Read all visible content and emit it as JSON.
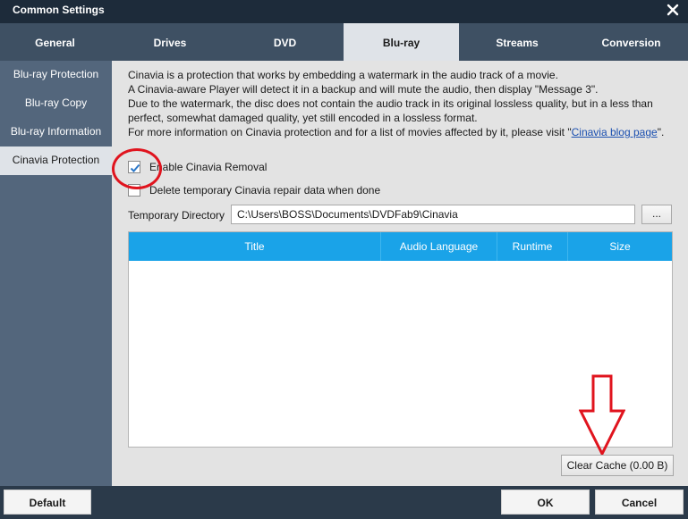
{
  "window": {
    "title": "Common Settings",
    "close_icon": "close-icon"
  },
  "tabs": [
    {
      "label": "General"
    },
    {
      "label": "Drives"
    },
    {
      "label": "DVD"
    },
    {
      "label": "Blu-ray",
      "active": true
    },
    {
      "label": "Streams"
    },
    {
      "label": "Conversion"
    }
  ],
  "sidebar": {
    "items": [
      {
        "label": "Blu-ray Protection"
      },
      {
        "label": "Blu-ray Copy"
      },
      {
        "label": "Blu-ray Information"
      },
      {
        "label": "Cinavia Protection",
        "active": true
      }
    ]
  },
  "main": {
    "description": {
      "line1": "Cinavia is a protection that works by embedding a watermark in the audio track of a movie.",
      "line2": "A Cinavia-aware Player will detect it in a backup and will mute the audio, then display \"Message 3\".",
      "line3": "Due to the watermark, the disc does not contain the audio track in its original lossless quality, but in a less than perfect, somewhat damaged quality, yet still encoded in a lossless format.",
      "line4_prefix": "For more information on Cinavia protection and for a list of movies affected by it, please visit \"",
      "link": "Cinavia blog page",
      "line4_suffix": "\"."
    },
    "options": {
      "enable_cinavia": {
        "label": "Enable Cinavia Removal",
        "checked": true
      },
      "delete_temp": {
        "label": "Delete temporary Cinavia repair data when done",
        "checked": false
      }
    },
    "temp_dir": {
      "label": "Temporary Directory",
      "value": "C:\\Users\\BOSS\\Documents\\DVDFab9\\Cinavia",
      "browse_label": "..."
    },
    "table": {
      "columns": [
        "Title",
        "Audio Language",
        "Runtime",
        "Size"
      ],
      "rows": []
    },
    "clear_cache_label": "Clear Cache (0.00 B)"
  },
  "footer": {
    "default_label": "Default",
    "ok_label": "OK",
    "cancel_label": "Cancel"
  },
  "colors": {
    "title_bar": "#1d2b3a",
    "tab_bar": "#3e5063",
    "sidebar": "#53667c",
    "table_header": "#1aa3e8",
    "annotation_red": "#e0141e"
  }
}
